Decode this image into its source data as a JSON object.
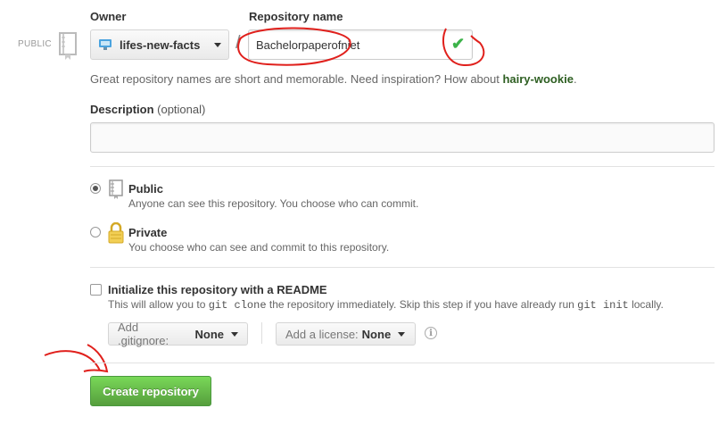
{
  "owner": {
    "label": "Owner",
    "visibility_tag": "PUBLIC",
    "selected": "lifes-new-facts"
  },
  "repo": {
    "label": "Repository name",
    "separator": "/",
    "value": "Bachelorpaperofniet",
    "valid": true
  },
  "hint": {
    "text": "Great repository names are short and memorable. Need inspiration? How about ",
    "suggestion": "hairy-wookie",
    "end": "."
  },
  "description": {
    "label": "Description",
    "optional": "(optional)",
    "value": ""
  },
  "visibility": {
    "public": {
      "title": "Public",
      "desc": "Anyone can see this repository. You choose who can commit.",
      "checked": true
    },
    "private": {
      "title": "Private",
      "desc": "You choose who can see and commit to this repository.",
      "checked": false
    }
  },
  "readme": {
    "title": "Initialize this repository with a README",
    "desc_1": "This will allow you to ",
    "code_1": "git clone",
    "desc_2": " the repository immediately. Skip this step if you have already run ",
    "code_2": "git init",
    "desc_3": " locally.",
    "checked": false
  },
  "gitignore": {
    "label": "Add .gitignore:",
    "value": "None"
  },
  "license": {
    "label": "Add a license:",
    "value": "None"
  },
  "info_glyph": "i",
  "create_button": "Create repository",
  "colors": {
    "accent_green": "#56a93d",
    "suggestion_green": "#2e5f22",
    "annotation_red": "#e0201c",
    "check_green": "#3cb34a"
  }
}
